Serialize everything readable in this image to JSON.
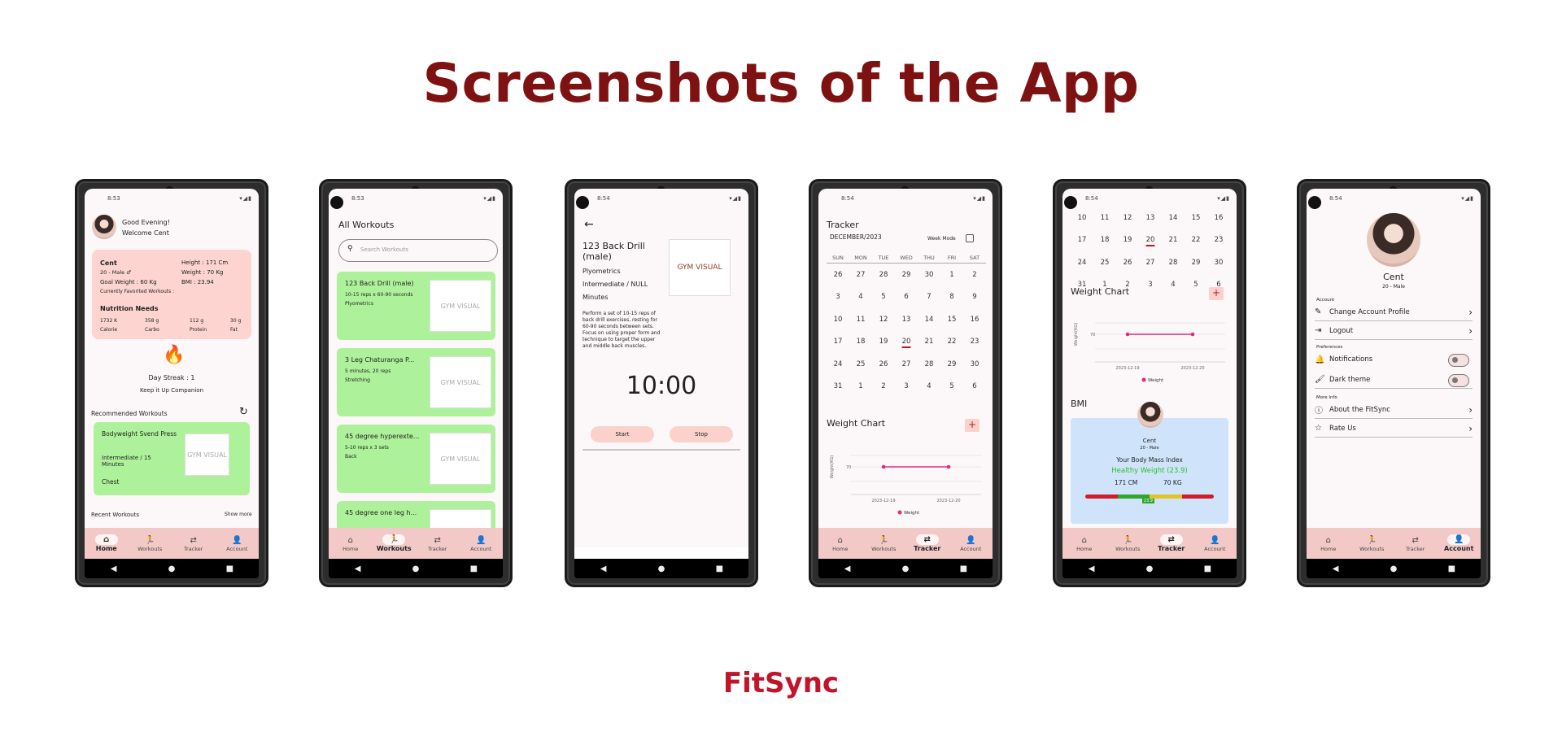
{
  "headline": "Screenshots of the App",
  "brand": "FitSync",
  "status_times": [
    "8:53",
    "8:53",
    "8:54",
    "8:54",
    "8:54"
  ],
  "tabs": {
    "home": "Home",
    "workouts": "Workouts",
    "tracker": "Tracker",
    "account": "Account"
  },
  "icons": {
    "home": "home-icon",
    "workouts": "running-figure-icon",
    "tracker": "swap-arrows-icon",
    "account": "person-icon",
    "streak": "flame-icon",
    "refresh": "refresh-icon",
    "search": "search-icon",
    "back": "arrow-left-icon"
  },
  "colors": {
    "headline": "#7e1111",
    "accent": "#c0152a",
    "pink_card": "#fdd4cf",
    "green_card": "#adf29a",
    "bmi_card": "#cfe4fb",
    "tabbar": "#f3c9c7"
  },
  "home": {
    "greeting": "Good Evening!",
    "welcome": "Welcome Cent",
    "name": "Cent",
    "age_sex": "20 - Male ♂",
    "goal_weight": "Goal Weight : 60 Kg",
    "favorited": "Currently Favorited Workouts :",
    "height": "Height : 171 Cm",
    "weight": "Weight : 70 Kg",
    "bmi": "BMI : 23.94",
    "nutrition_title": "Nutrition Needs",
    "nutrition": [
      {
        "value": "1732 K",
        "label": "Calorie"
      },
      {
        "value": "358 g",
        "label": "Carbo"
      },
      {
        "value": "112 g",
        "label": "Protein"
      },
      {
        "value": "30 g",
        "label": "Fat"
      }
    ],
    "streak": "Day Streak : 1",
    "streak_sub": "Keep it Up Companion",
    "recommended": "Recommended Workouts",
    "rec_card": {
      "title": "Bodyweight Svend Press",
      "line": "Intermediate / 15 Minutes",
      "part": "Chest"
    },
    "thumb_text": "GYM VISUAL",
    "recent": "Recent Workouts",
    "show_more": "Show more"
  },
  "workouts": {
    "title": "All Workouts",
    "search_placeholder": "Search Workouts",
    "items": [
      {
        "title": "123 Back Drill (male)",
        "line1": "10-15 reps x 60-90 seconds",
        "line2": "Plyometrics"
      },
      {
        "title": "3 Leg Chaturanga P...",
        "line1": "5 minutes, 20 reps",
        "line2": "Stretching"
      },
      {
        "title": "45 degree hyperexte...",
        "line1": "5-10 reps x 3 sets",
        "line2": "Back"
      },
      {
        "title": "45 degree one leg h...",
        "line1": "",
        "line2": ""
      }
    ]
  },
  "detail": {
    "title": "123 Back Drill (male)",
    "type": "Plyometrics",
    "level": "Intermediate / NULL",
    "unit": "Minutes",
    "description": "Perform a set of 10-15 reps of back drill exercises, resting for 60-90 seconds between sets. Focus on using proper form and technique to target the upper and middle back muscles.",
    "timer": "10:00",
    "start": "Start",
    "stop": "Stop",
    "thumb_text": "GYM VISUAL"
  },
  "tracker": {
    "title": "Tracker",
    "month": "DECEMBER/2023",
    "week_mode": "Week Mode",
    "weekdays": [
      "SUN",
      "MON",
      "TUE",
      "WED",
      "THU",
      "FRI",
      "SAT"
    ],
    "days": [
      "26",
      "27",
      "28",
      "29",
      "30",
      "1",
      "2",
      "3",
      "4",
      "5",
      "6",
      "7",
      "8",
      "9",
      "10",
      "11",
      "12",
      "13",
      "14",
      "15",
      "16",
      "17",
      "18",
      "19",
      "20",
      "21",
      "22",
      "23",
      "24",
      "25",
      "26",
      "27",
      "28",
      "29",
      "30",
      "31",
      "1",
      "2",
      "3",
      "4",
      "5",
      "6"
    ],
    "selected_day_index": 24,
    "weight_chart": "Weight Chart",
    "chart_ylabel": "Weight(KG)",
    "legend": "Weight"
  },
  "tracker2": {
    "weight_chart": "Weight Chart",
    "bmi": "BMI",
    "bmi_name": "Cent",
    "bmi_sub": "20 - Male",
    "bmi_title": "Your Body Mass Index",
    "bmi_status": "Healthy Weight (23.9)",
    "bmi_height": "171 CM",
    "bmi_weight": "70 KG",
    "bmi_marker": "23.9",
    "bmi_fraction": 0.48
  },
  "chart_data": [
    {
      "type": "line",
      "x": [
        "2023-12-19",
        "2023-12-20"
      ],
      "series": [
        {
          "name": "Weight",
          "values": [
            70,
            70
          ]
        }
      ],
      "ylabel": "Weight(KG)",
      "ytick": "70"
    },
    {
      "type": "line",
      "x": [
        "2023-12-19",
        "2023-12-20"
      ],
      "series": [
        {
          "name": "Weight",
          "values": [
            70,
            70
          ]
        }
      ],
      "ylabel": "Weight(KG)",
      "ytick": "70"
    }
  ],
  "account": {
    "name": "Cent",
    "sub": "20 - Male",
    "section_account": "Account",
    "change_profile": "Change Account Profile",
    "logout": "Logout",
    "section_prefs": "Preferences",
    "notifications": "Notifications",
    "dark_theme": "Dark theme",
    "section_more": "More Info",
    "about": "About the FitSync",
    "rate": "Rate Us"
  }
}
